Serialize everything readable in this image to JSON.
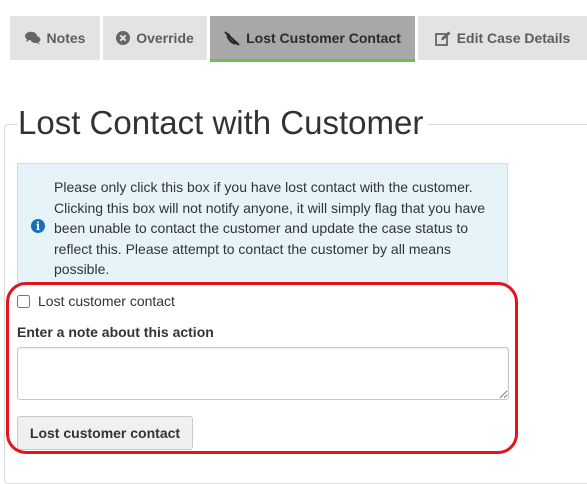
{
  "tabs": [
    {
      "label": "Notes",
      "icon": "comments-icon",
      "active": false
    },
    {
      "label": "Override",
      "icon": "times-circle-icon",
      "active": false
    },
    {
      "label": "Lost Customer Contact",
      "icon": "phone-slash-icon",
      "active": true
    },
    {
      "label": "Edit Case Details",
      "icon": "edit-icon",
      "active": false
    }
  ],
  "page": {
    "title": "Lost Contact with Customer"
  },
  "info": {
    "icon": "info-circle-icon",
    "text": "Please only click this box if you have lost contact with the customer. Clicking this box will not notify anyone, it will simply flag that you have been unable to contact the customer and update the case status to reflect this. Please attempt to contact the customer by all means possible."
  },
  "form": {
    "checkbox_label": "Lost customer contact",
    "checkbox_checked": false,
    "note_label": "Enter a note about this action",
    "note_value": "",
    "note_placeholder": "",
    "submit_label": "Lost customer contact"
  },
  "colors": {
    "active_tab_bg": "#a8a8a8",
    "active_tab_underline": "#6cc04a",
    "info_bg": "#e6f4fa",
    "info_icon": "#1a6fb8",
    "highlight": "#e4141b"
  }
}
